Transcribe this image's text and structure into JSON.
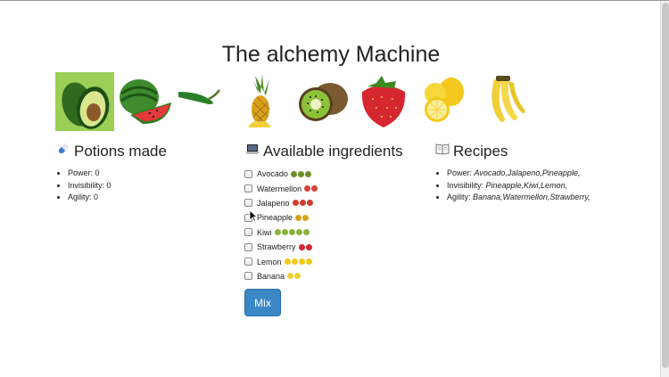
{
  "title": "The alchemy Machine",
  "fruit_images": [
    {
      "icon": "avocado-icon"
    },
    {
      "icon": "watermelon-icon"
    },
    {
      "icon": "jalapeno-icon"
    },
    {
      "icon": "pineapple-icon"
    },
    {
      "icon": "kiwi-icon"
    },
    {
      "icon": "strawberry-icon"
    },
    {
      "icon": "lemon-icon"
    },
    {
      "icon": "banana-icon"
    }
  ],
  "potions": {
    "heading": "Potions made",
    "heading_icon": "pill-icon",
    "items": [
      {
        "label": "Power: 0"
      },
      {
        "label": "Invisibility: 0"
      },
      {
        "label": "Agility: 0"
      }
    ]
  },
  "ingredients": {
    "heading": "Available ingredients",
    "heading_icon": "laptop-icon",
    "items": [
      {
        "name": "Avocado",
        "emoji_count": 3,
        "color": "#6e8f2b"
      },
      {
        "name": "Watermellon",
        "emoji_count": 2,
        "color": "#d8423a"
      },
      {
        "name": "Jalapeno",
        "emoji_count": 3,
        "color": "#cf3b2d"
      },
      {
        "name": "Pineapple",
        "emoji_count": 2,
        "color": "#d8a21a"
      },
      {
        "name": "Kiwi",
        "emoji_count": 5,
        "color": "#8bb33a"
      },
      {
        "name": "Strawberry",
        "emoji_count": 2,
        "color": "#d6262f"
      },
      {
        "name": "Lemon",
        "emoji_count": 4,
        "color": "#f2c91c"
      },
      {
        "name": "Banana",
        "emoji_count": 2,
        "color": "#f0cf3a"
      }
    ],
    "mix_label": "Mix"
  },
  "recipes": {
    "heading": "Recipes",
    "heading_icon": "open-book-icon",
    "items": [
      {
        "label": "Power: ",
        "ingredients": "Avocado,Jalapeno,Pineapple,"
      },
      {
        "label": "Invisibility: ",
        "ingredients": "Pineapple,Kiwi,Lemon,"
      },
      {
        "label": "Agility: ",
        "ingredients": "Banana,Watermellon,Strawberry,"
      }
    ]
  }
}
